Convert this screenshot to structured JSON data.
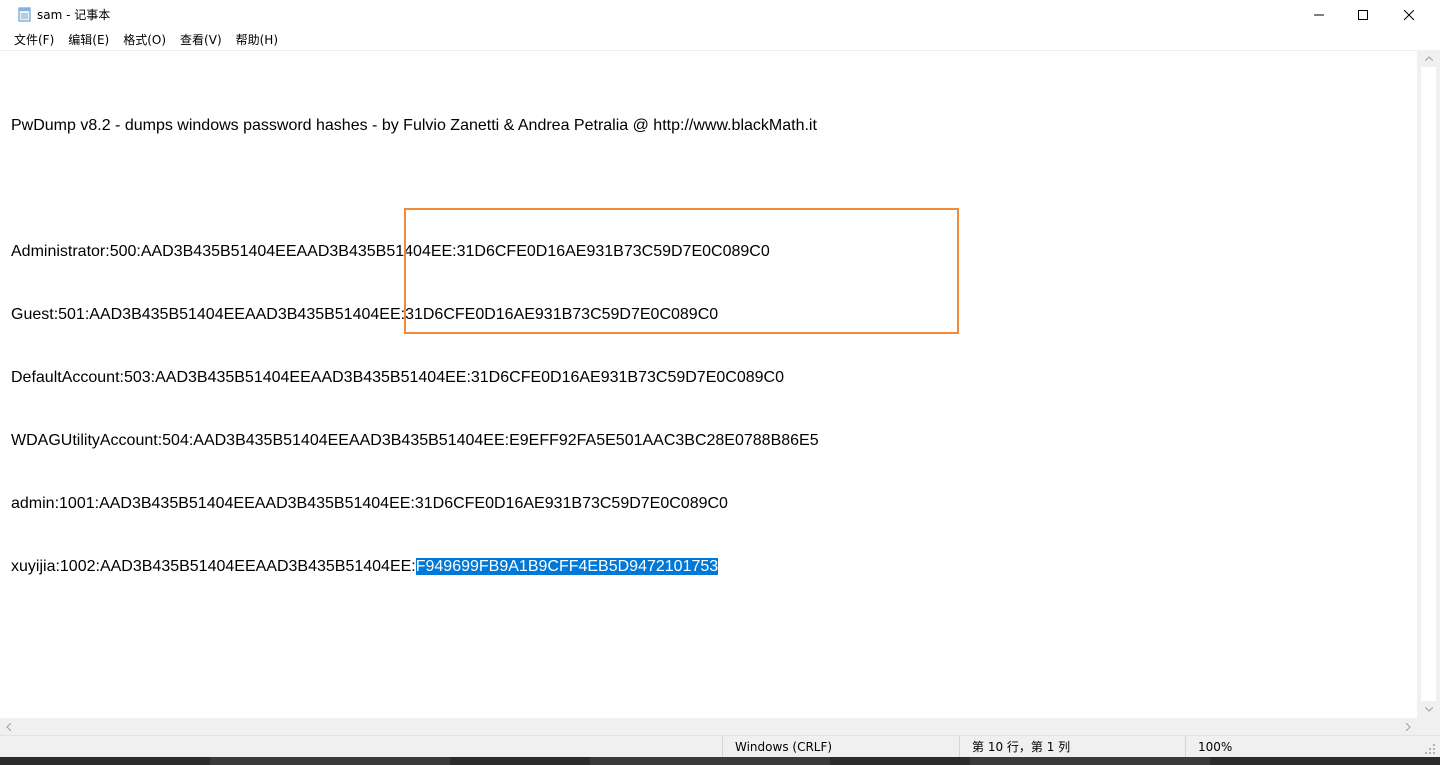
{
  "window": {
    "title": "sam - 记事本",
    "icons": {
      "app": "notepad-icon",
      "minimize": "minimize-icon",
      "maximize": "maximize-icon",
      "close": "close-icon"
    }
  },
  "menu": {
    "items": [
      {
        "label": "文件(F)"
      },
      {
        "label": "编辑(E)"
      },
      {
        "label": "格式(O)"
      },
      {
        "label": "查看(V)"
      },
      {
        "label": "帮助(H)"
      }
    ]
  },
  "editor": {
    "lines": [
      "PwDump v8.2 - dumps windows password hashes - by Fulvio Zanetti & Andrea Petralia @ http://www.blackMath.it",
      "",
      "Administrator:500:AAD3B435B51404EEAAD3B435B51404EE:31D6CFE0D16AE931B73C59D7E0C089C0",
      "Guest:501:AAD3B435B51404EEAAD3B435B51404EE:31D6CFE0D16AE931B73C59D7E0C089C0",
      "DefaultAccount:503:AAD3B435B51404EEAAD3B435B51404EE:31D6CFE0D16AE931B73C59D7E0C089C0",
      "WDAGUtilityAccount:504:AAD3B435B51404EEAAD3B435B51404EE:E9EFF92FA5E501AAC3BC28E0788B86E5",
      "admin:1001:AAD3B435B51404EEAAD3B435B51404EE:31D6CFE0D16AE931B73C59D7E0C089C0"
    ],
    "last_line_prefix": "xuyijia:1002:AAD3B435B51404EEAAD3B435B51404EE:",
    "last_line_selected": "F949699FB9A1B9CFF4EB5D9472101753",
    "selection_color": "#0078d7",
    "annotation_color": "#f08a3a"
  },
  "statusbar": {
    "encoding": "Windows (CRLF)",
    "position": "第 10 行，第 1 列",
    "zoom": "100%"
  }
}
